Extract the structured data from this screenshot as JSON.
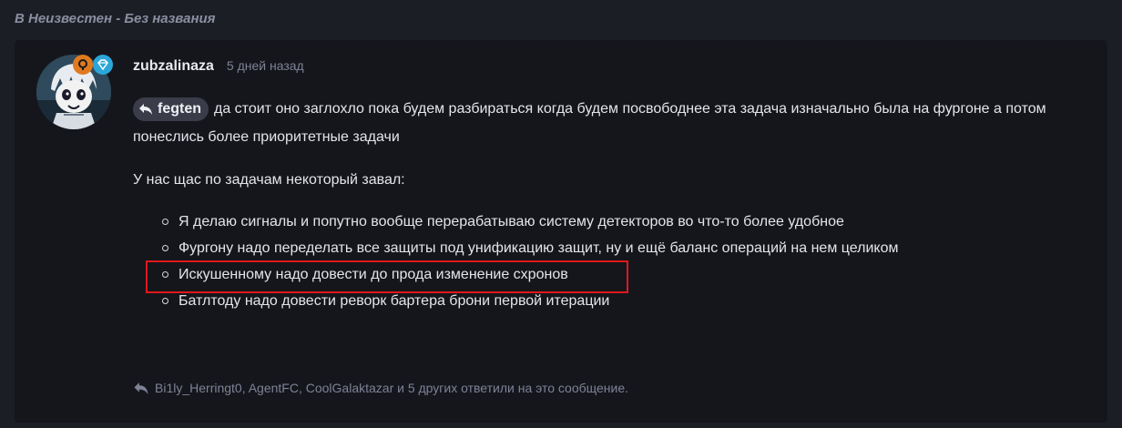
{
  "breadcrumb": "В Неизвестен - Без названия",
  "post": {
    "username": "zubzalinaza",
    "timestamp": "5 дней назад",
    "mention": "fegten",
    "paragraph1": "да стоит оно заглохло пока будем разбираться когда будем посвободнее эта задача изначально была на фургоне а потом понеслись более приоритетные задачи",
    "paragraph2": "У нас щас по задачам некоторый завал:",
    "tasks": [
      "Я делаю сигналы и попутно вообще перерабатываю систему детекторов во что-то более удобное",
      "Фургону надо переделать все защиты под унификацию защит, ну и ещё баланс операций на нем целиком",
      "Искушенному надо довести до прода изменение схронов",
      "Батлтоду надо довести реворк бартера брони первой итерации"
    ],
    "replies": "Bi1ly_Herringt0, AgentFC, CoolGalaktazar и 5 других ответили на это сообщение."
  },
  "colors": {
    "highlight": "#e0181b",
    "badge_orange": "#e07a1f",
    "badge_blue": "#2ca6d8"
  },
  "icons": {
    "badge1": "ring-badge-icon",
    "badge2": "diamond-badge-icon",
    "mention": "reply-arrow-icon",
    "replies": "reply-arrow-icon"
  }
}
